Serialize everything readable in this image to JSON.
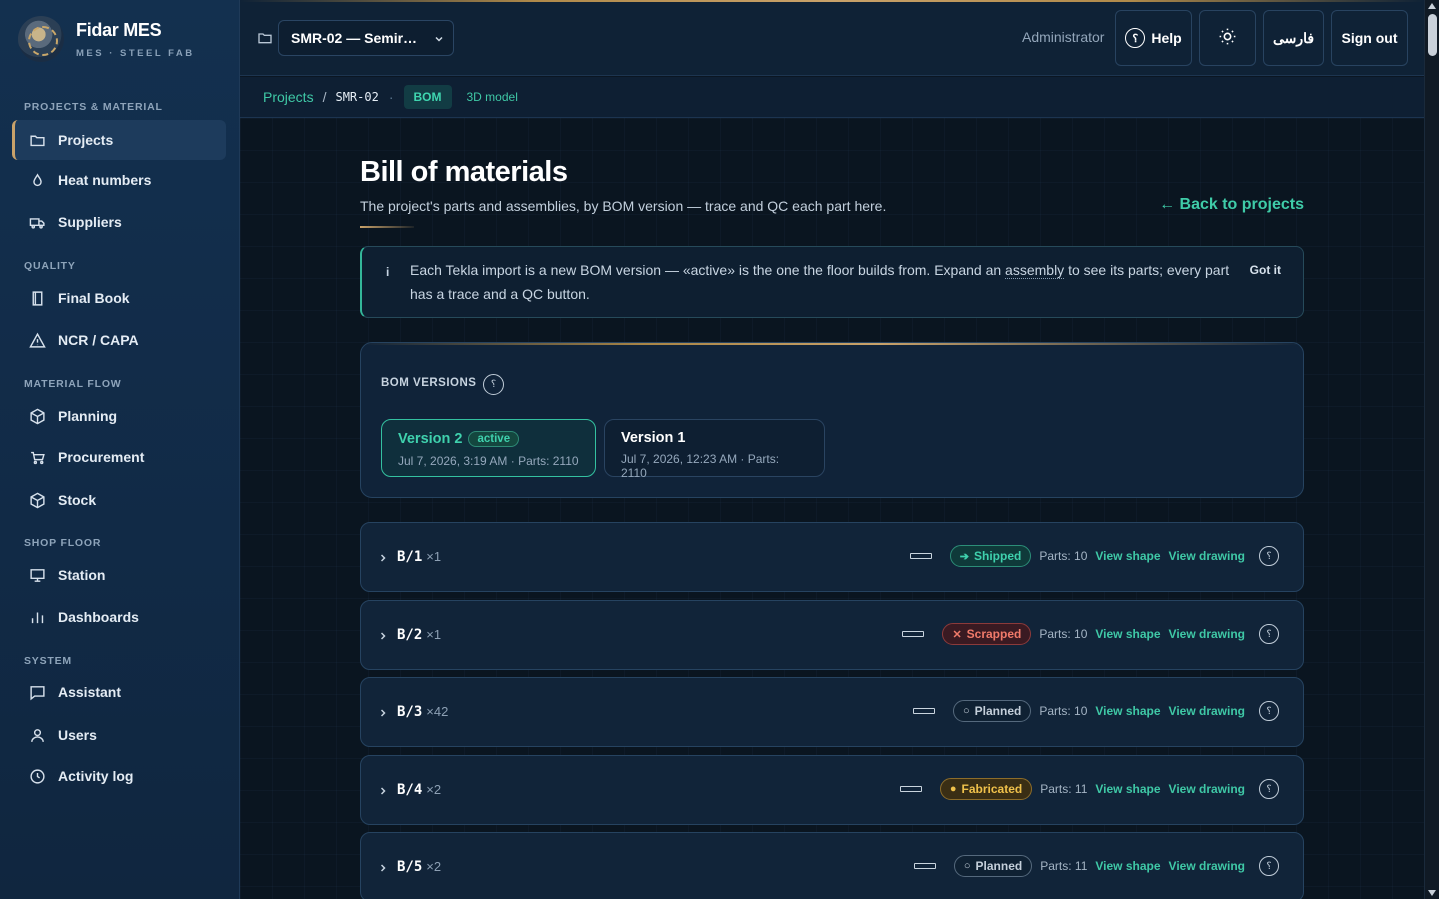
{
  "brand": {
    "title": "Fidar MES",
    "subtitle": "MES · STEEL FAB"
  },
  "sidebar": {
    "sections": [
      {
        "title": "PROJECTS & MATERIAL"
      },
      {
        "title": "QUALITY"
      },
      {
        "title": "MATERIAL FLOW"
      },
      {
        "title": "SHOP FLOOR"
      },
      {
        "title": "SYSTEM"
      }
    ],
    "items": [
      {
        "label": "Projects",
        "icon": "folder-icon",
        "active": true
      },
      {
        "label": "Heat numbers",
        "icon": "flame-icon"
      },
      {
        "label": "Suppliers",
        "icon": "truck-icon"
      },
      {
        "label": "Final Book",
        "icon": "book-icon"
      },
      {
        "label": "NCR / CAPA",
        "icon": "warning-icon"
      },
      {
        "label": "Planning",
        "icon": "cube-icon"
      },
      {
        "label": "Procurement",
        "icon": "cart-icon"
      },
      {
        "label": "Stock",
        "icon": "box-icon"
      },
      {
        "label": "Station",
        "icon": "monitor-icon"
      },
      {
        "label": "Dashboards",
        "icon": "bar-chart-icon"
      },
      {
        "label": "Assistant",
        "icon": "chat-icon"
      },
      {
        "label": "Users",
        "icon": "user-icon"
      },
      {
        "label": "Activity log",
        "icon": "clock-icon"
      }
    ]
  },
  "topbar": {
    "project_select": "SMR-02 — Semir…",
    "user": "Administrator",
    "help": "Help",
    "language": "فارسی",
    "sign_out": "Sign out"
  },
  "breadcrumb": {
    "projects": "Projects",
    "sep": "/",
    "current": "SMR-02",
    "dot": "·",
    "bom_tab": "BOM",
    "model_tab": "3D model"
  },
  "page": {
    "title": "Bill of materials",
    "subtitle": "The project's parts and assemblies, by BOM version — trace and QC each part here.",
    "back_link": "← Back to projects"
  },
  "info": {
    "icon_label": "i",
    "text_before": "Each Tekla import is a new BOM version — «active» is the one the floor builds from. Expand an ",
    "text_term": "assembly",
    "text_after": " to see its parts; every part has a trace and a QC button.",
    "dismiss": "Got it"
  },
  "versions": {
    "label": "BOM VERSIONS",
    "help": "؟",
    "items": [
      {
        "name": "Version 2",
        "badge": "active",
        "meta": "Jul 7, 2026, 3:19 AM · Parts: 2110"
      },
      {
        "name": "Version 1",
        "meta": "Jul 7, 2026, 12:23 AM · Parts: 2110"
      }
    ]
  },
  "assemblies": [
    {
      "mark": "B/1",
      "qty": "×1",
      "status": "Shipped",
      "status_icon": "➔",
      "parts": "Parts: 10"
    },
    {
      "mark": "B/2",
      "qty": "×1",
      "status": "Scrapped",
      "status_icon": "✕",
      "parts": "Parts: 10"
    },
    {
      "mark": "B/3",
      "qty": "×42",
      "status": "Planned",
      "status_icon": "○",
      "parts": "Parts: 10"
    },
    {
      "mark": "B/4",
      "qty": "×2",
      "status": "Fabricated",
      "status_icon": "●",
      "parts": "Parts: 11"
    },
    {
      "mark": "B/5",
      "qty": "×2",
      "status": "Planned",
      "status_icon": "○",
      "parts": "Parts: 11"
    }
  ],
  "assembly_actions": {
    "view_shape": "View shape",
    "view_drawing": "View drawing",
    "help": "؟"
  },
  "colors": {
    "accent": "#3fc8a6",
    "gold": "#c9a26a",
    "bg": "#0b1622",
    "sidebar": "#13304f"
  }
}
